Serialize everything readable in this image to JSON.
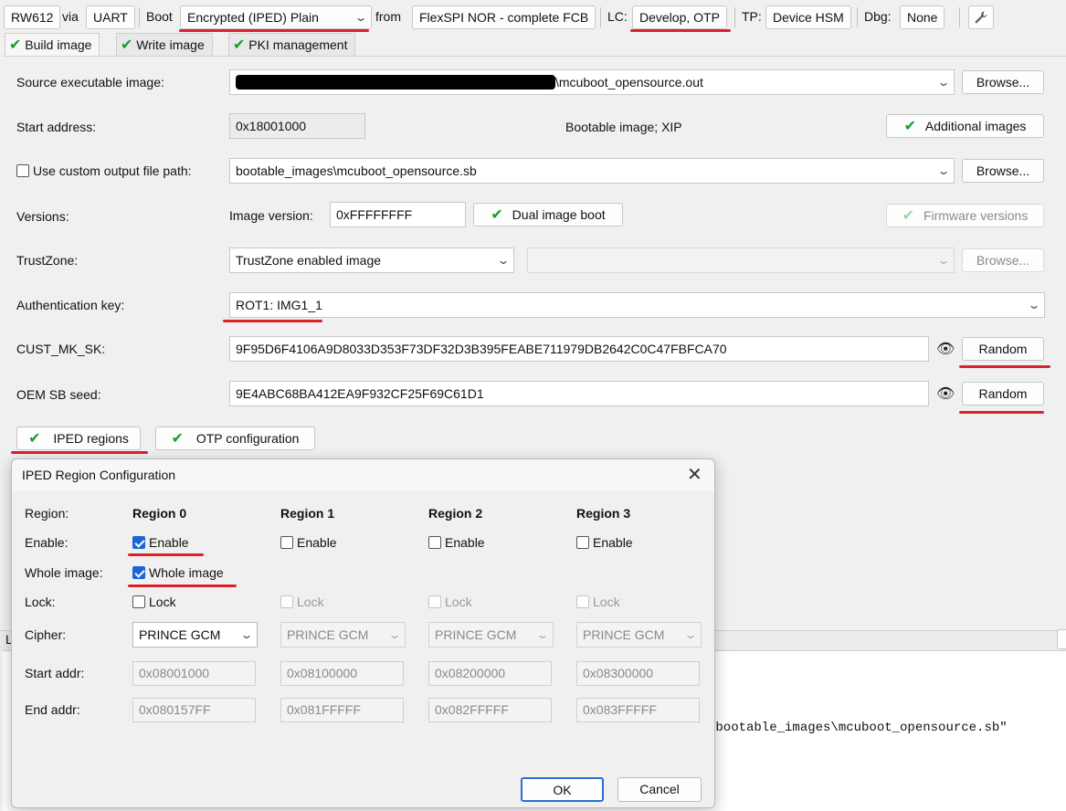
{
  "toolbar": {
    "device": "RW612",
    "via_label": "via",
    "interface": "UART",
    "boot_label": "Boot",
    "boot_value": "Encrypted (IPED) Plain",
    "from_label": "from",
    "from_value": "FlexSPI NOR - complete FCB",
    "lc_label": "LC:",
    "lc_value": "Develop, OTP",
    "tp_label": "TP:",
    "tp_value": "Device HSM",
    "dbg_label": "Dbg:",
    "dbg_value": "None",
    "settings_icon": "wrench-icon"
  },
  "tabs": [
    {
      "label": "Build image",
      "active": true
    },
    {
      "label": "Write image",
      "active": false
    },
    {
      "label": "PKI management",
      "active": false
    }
  ],
  "build": {
    "source_label": "Source executable image:",
    "source_value": "\\mcuboot_opensource.out",
    "browse_label": "Browse...",
    "start_label": "Start address:",
    "start_value": "0x18001000",
    "bootable_text": "Bootable image; XIP",
    "additional_images": "Additional images",
    "custom_output_label": "Use custom output file path:",
    "custom_output_checked": false,
    "output_value": "bootable_images\\mcuboot_opensource.sb",
    "versions_label": "Versions:",
    "image_version_label": "Image version:",
    "image_version_value": "0xFFFFFFFF",
    "dual_image_boot": "Dual image boot",
    "firmware_versions": "Firmware versions",
    "trustzone_label": "TrustZone:",
    "trustzone_value": "TrustZone enabled image",
    "auth_key_label": "Authentication key:",
    "auth_key_value": "ROT1: IMG1_1",
    "cust_mk_label": "CUST_MK_SK:",
    "cust_mk_value": "9F95D6F4106A9D8033D353F73DF32D3B395FEABE711979DB2642C0C47FBFCA70",
    "oem_seed_label": "OEM SB seed:",
    "oem_seed_value": "9E4ABC68BA412EA9F932CF25F69C61D1",
    "random_label": "Random",
    "iped_regions": "IPED regions",
    "otp_configuration": "OTP configuration"
  },
  "log": {
    "tab_letter": "L",
    "line_path": "\\bootable_images\\mcuboot_opensource.sb\""
  },
  "dialog": {
    "title": "IPED Region Configuration",
    "row_labels": {
      "region": "Region:",
      "enable": "Enable:",
      "whole": "Whole image:",
      "lock": "Lock:",
      "cipher": "Cipher:",
      "start": "Start addr:",
      "end": "End addr:"
    },
    "enable_text": "Enable",
    "whole_text": "Whole image",
    "lock_text": "Lock",
    "regions": [
      {
        "name": "Region 0",
        "enabled": true,
        "whole": true,
        "lock": false,
        "cipher": "PRINCE GCM",
        "start": "0x08001000",
        "end": "0x080157FF"
      },
      {
        "name": "Region 1",
        "enabled": false,
        "lock": false,
        "cipher": "PRINCE GCM",
        "start": "0x08100000",
        "end": "0x081FFFFF"
      },
      {
        "name": "Region 2",
        "enabled": false,
        "lock": false,
        "cipher": "PRINCE GCM",
        "start": "0x08200000",
        "end": "0x082FFFFF"
      },
      {
        "name": "Region 3",
        "enabled": false,
        "lock": false,
        "cipher": "PRINCE GCM",
        "start": "0x08300000",
        "end": "0x083FFFFF"
      }
    ],
    "ok_label": "OK",
    "cancel_label": "Cancel"
  },
  "colors": {
    "highlight_red": "#d9232c",
    "check_green": "#1a9c2a",
    "checkbox_blue": "#1f63d6"
  }
}
